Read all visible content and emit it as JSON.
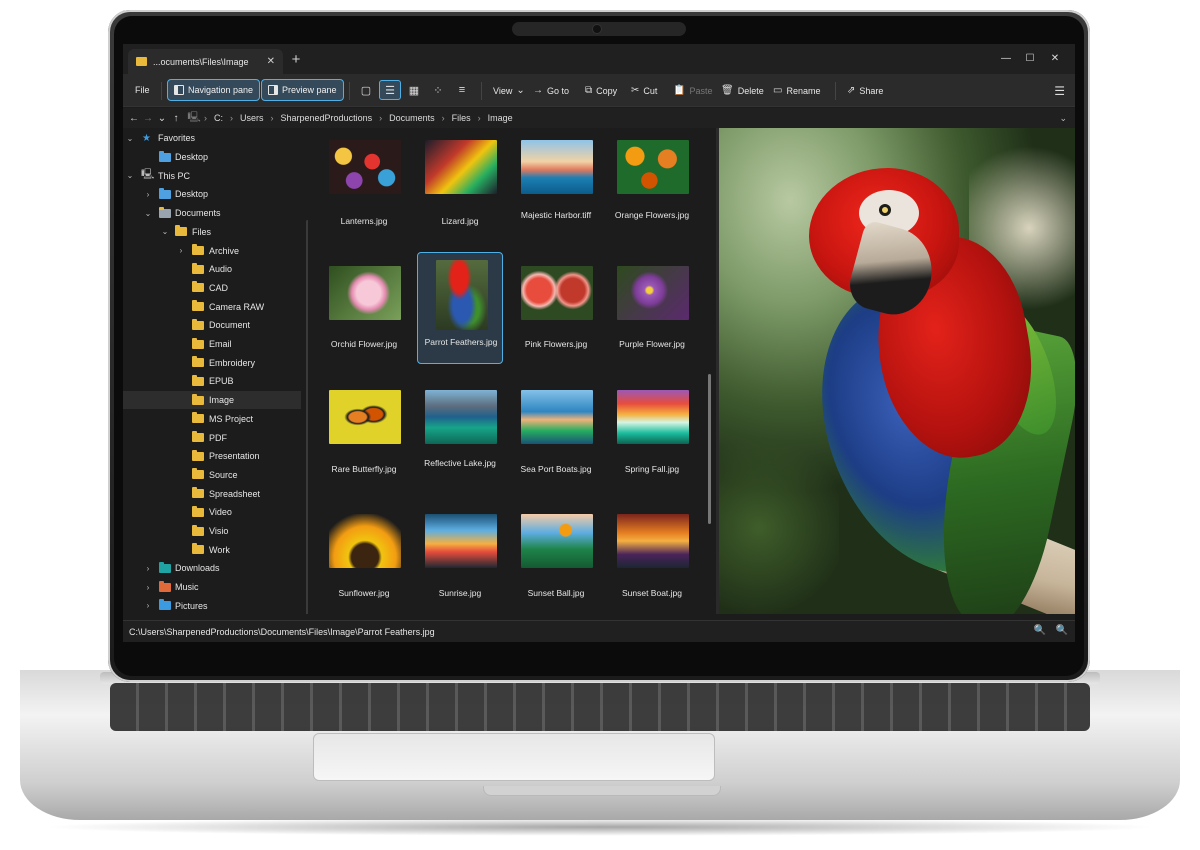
{
  "tab": {
    "title": "...ocuments\\Files\\Image"
  },
  "toolbar": {
    "file": "File",
    "navigation_pane": "Navigation pane",
    "preview_pane": "Preview pane",
    "view": "View",
    "go_to": "Go to",
    "copy": "Copy",
    "cut": "Cut",
    "paste": "Paste",
    "delete": "Delete",
    "rename": "Rename",
    "share": "Share"
  },
  "address": {
    "crumbs": [
      "C:",
      "Users",
      "SharpenedProductions",
      "Documents",
      "Files",
      "Image"
    ]
  },
  "tree": [
    {
      "label": "Favorites"
    },
    {
      "label": "Desktop"
    },
    {
      "label": "This PC"
    },
    {
      "label": "Desktop"
    },
    {
      "label": "Documents"
    },
    {
      "label": "Files"
    },
    {
      "label": "Archive"
    },
    {
      "label": "Audio"
    },
    {
      "label": "CAD"
    },
    {
      "label": "Camera RAW"
    },
    {
      "label": "Document"
    },
    {
      "label": "Email"
    },
    {
      "label": "Embroidery"
    },
    {
      "label": "EPUB"
    },
    {
      "label": "Image"
    },
    {
      "label": "MS Project"
    },
    {
      "label": "PDF"
    },
    {
      "label": "Presentation"
    },
    {
      "label": "Source"
    },
    {
      "label": "Spreadsheet"
    },
    {
      "label": "Video"
    },
    {
      "label": "Visio"
    },
    {
      "label": "Work"
    },
    {
      "label": "Downloads"
    },
    {
      "label": "Music"
    },
    {
      "label": "Pictures"
    }
  ],
  "files": [
    {
      "name": "Lanterns.jpg"
    },
    {
      "name": "Lizard.jpg"
    },
    {
      "name": "Majestic Harbor.tiff"
    },
    {
      "name": "Orange Flowers.jpg"
    },
    {
      "name": "Orchid Flower.jpg"
    },
    {
      "name": "Parrot Feathers.jpg"
    },
    {
      "name": "Pink Flowers.jpg"
    },
    {
      "name": "Purple Flower.jpg"
    },
    {
      "name": "Rare Butterfly.jpg"
    },
    {
      "name": "Reflective Lake.jpg"
    },
    {
      "name": "Sea Port Boats.jpg"
    },
    {
      "name": "Spring Fall.jpg"
    },
    {
      "name": "Sunflower.jpg"
    },
    {
      "name": "Sunrise.jpg"
    },
    {
      "name": "Sunset Ball.jpg"
    },
    {
      "name": "Sunset Boat.jpg"
    }
  ],
  "status": {
    "path": "C:\\Users\\SharpenedProductions\\Documents\\Files\\Image\\Parrot Feathers.jpg"
  },
  "colors": {
    "accent": "#4fb0e8",
    "folder": "#e8b93b",
    "background": "#1c1c1c"
  }
}
